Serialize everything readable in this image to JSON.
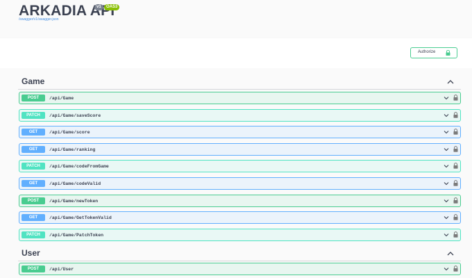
{
  "header": {
    "title": "ARKADIA API",
    "version_badge": "v1",
    "spec_badge": "OAS3",
    "spec_url": "/swagger/v1/swagger.json"
  },
  "scheme": {
    "authorize_label": "Authorize",
    "authorize_icon": "lock-icon"
  },
  "colors": {
    "post": "#49cc90",
    "get": "#61affe",
    "patch": "#50e3c2"
  },
  "sections": [
    {
      "tag": "Game",
      "expanded": true,
      "operations": [
        {
          "method": "POST",
          "path": "/api/Game"
        },
        {
          "method": "PATCH",
          "path": "/api/Game/saveScore"
        },
        {
          "method": "GET",
          "path": "/api/Game/score"
        },
        {
          "method": "GET",
          "path": "/api/Game/ranking"
        },
        {
          "method": "PATCH",
          "path": "/api/Game/codeFromGame"
        },
        {
          "method": "GET",
          "path": "/api/Game/codeValid"
        },
        {
          "method": "POST",
          "path": "/api/Game/newToken"
        },
        {
          "method": "GET",
          "path": "/api/Game/GetTokenValid"
        },
        {
          "method": "PATCH",
          "path": "/api/Game/PatchToken"
        }
      ]
    },
    {
      "tag": "User",
      "expanded": true,
      "operations": [
        {
          "method": "POST",
          "path": "/api/User"
        }
      ]
    }
  ]
}
